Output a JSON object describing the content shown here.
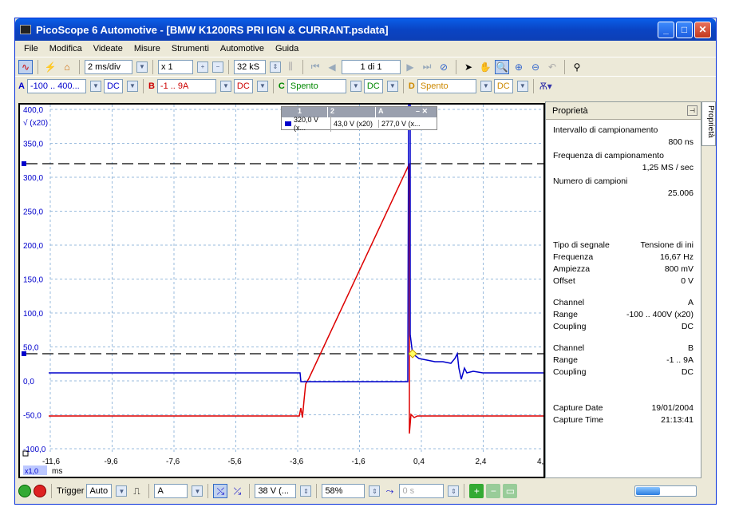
{
  "window": {
    "title": "PicoScope 6 Automotive - [BMW K1200RS PRI IGN & CURRANT.psdata]"
  },
  "menu": [
    "File",
    "Modifica",
    "Videate",
    "Misure",
    "Strumenti",
    "Automotive",
    "Guida"
  ],
  "toolbar": {
    "timebase": "2 ms/div",
    "zoom": "x 1",
    "samples": "32 kS",
    "buffer": "1 di 1"
  },
  "channels": {
    "a": {
      "letter": "A",
      "range": "-100 .. 400...",
      "coupling": "DC"
    },
    "b": {
      "letter": "B",
      "range": "-1 .. 9A",
      "coupling": "DC"
    },
    "c": {
      "letter": "C",
      "range": "Spento",
      "coupling": "DC"
    },
    "d": {
      "letter": "D",
      "range": "Spento",
      "coupling": "DC"
    }
  },
  "ruler_table": {
    "headers": [
      "1",
      "2",
      "A"
    ],
    "values": [
      "320,0 V (x...",
      "43,0 V (x20)",
      "277,0 V (x..."
    ]
  },
  "scope": {
    "y_unit": "√ (x20)",
    "y_ticks": [
      "400,0",
      "350,0",
      "300,0",
      "250,0",
      "200,0",
      "150,0",
      "100,0",
      "50,0",
      "0,0",
      "-50,0",
      "-100,0"
    ],
    "x_ticks": [
      "-11,6",
      "-9,6",
      "-7,6",
      "-5,6",
      "-3,6",
      "-1,6",
      "0,4",
      "2,4",
      "4,"
    ],
    "x_unit": "ms",
    "x_zoom": "x1,0"
  },
  "properties": {
    "title": "Proprietà",
    "tab": "Proprietà",
    "rows1": [
      {
        "label": "Intervallo di campionamento",
        "value": ""
      },
      {
        "label": "",
        "value": "800 ns"
      },
      {
        "label": "Frequenza di campionamento",
        "value": ""
      },
      {
        "label": "",
        "value": "1,25 MS / sec"
      },
      {
        "label": "Numero di campioni",
        "value": ""
      },
      {
        "label": "",
        "value": "25.006"
      }
    ],
    "rows2": [
      {
        "label": "Tipo di segnale",
        "value": "Tensione di ini"
      },
      {
        "label": "Frequenza",
        "value": "16,67 Hz"
      },
      {
        "label": "Ampiezza",
        "value": "800 mV"
      },
      {
        "label": "Offset",
        "value": "0 V"
      }
    ],
    "rows3": [
      {
        "label": "Channel",
        "value": "A"
      },
      {
        "label": "Range",
        "value": "-100 .. 400V (x20)"
      },
      {
        "label": "Coupling",
        "value": "DC"
      }
    ],
    "rows4": [
      {
        "label": "Channel",
        "value": "B"
      },
      {
        "label": "Range",
        "value": "-1 .. 9A"
      },
      {
        "label": "Coupling",
        "value": "DC"
      }
    ],
    "rows5": [
      {
        "label": "Capture Date",
        "value": "19/01/2004"
      },
      {
        "label": "Capture Time",
        "value": "21:13:41"
      }
    ]
  },
  "bottom": {
    "trigger_label": "Trigger",
    "trigger_mode": "Auto",
    "trigger_source": "A",
    "trigger_level": "38 V (...",
    "pre_trigger": "58%",
    "delay": "0 s"
  }
}
